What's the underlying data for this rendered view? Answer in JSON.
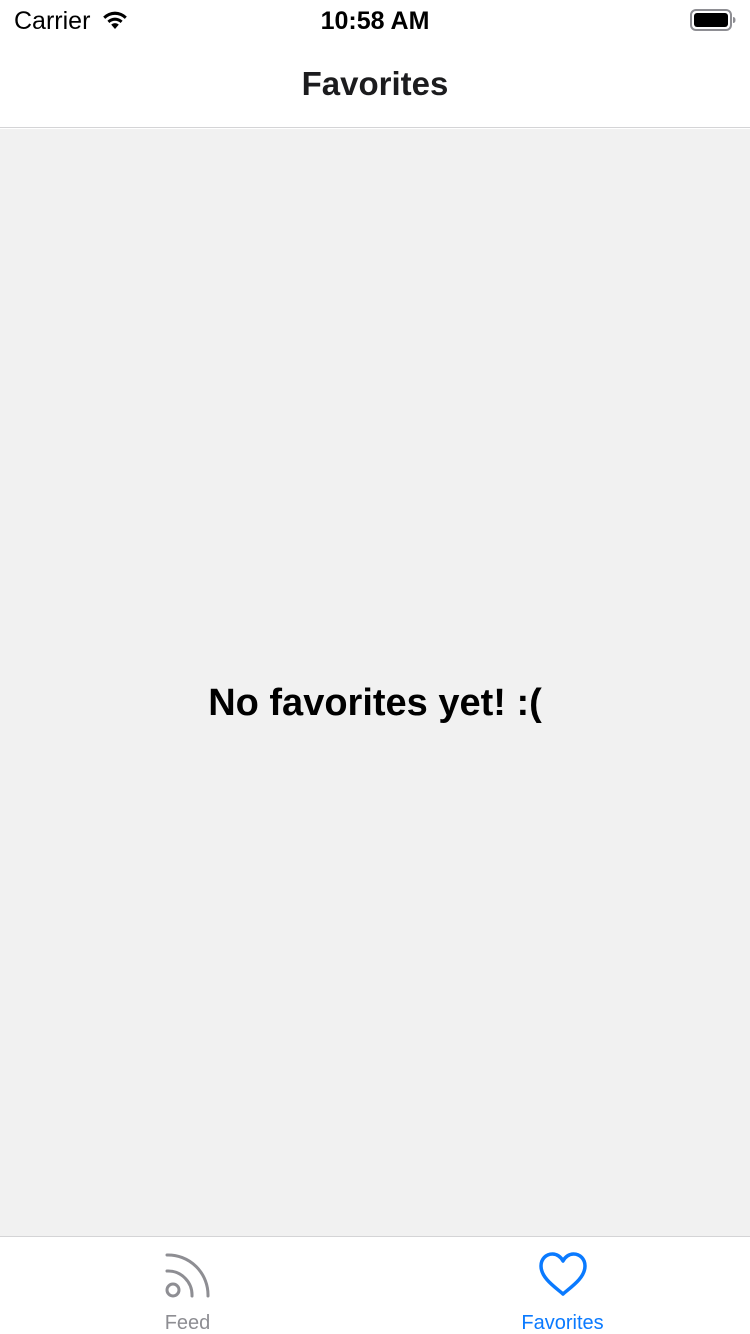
{
  "status_bar": {
    "carrier": "Carrier",
    "time": "10:58 AM",
    "wifi_icon": "wifi-icon",
    "battery_icon": "battery-icon"
  },
  "nav": {
    "title": "Favorites"
  },
  "content": {
    "empty_message": "No favorites yet! :(",
    "background": "#f1f1f1"
  },
  "tab_bar": {
    "tabs": [
      {
        "label": "Feed",
        "icon": "rss-feed-icon",
        "selected": false,
        "color": "#8e8e93"
      },
      {
        "label": "Favorites",
        "icon": "heart-icon",
        "selected": true,
        "color": "#0a7aff"
      }
    ]
  }
}
